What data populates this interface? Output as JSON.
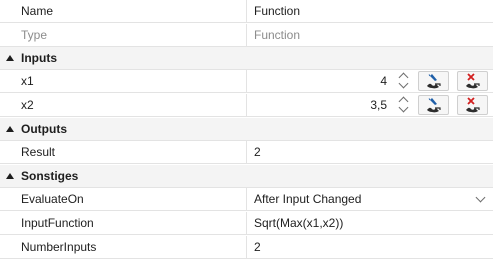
{
  "header": {
    "name": "Name",
    "value": "Function"
  },
  "type_row": {
    "name": "Type",
    "value": "Function"
  },
  "categories": {
    "inputs": "Inputs",
    "outputs": "Outputs",
    "sonstiges": "Sonstiges"
  },
  "inputs": [
    {
      "name": "x1",
      "value": "4"
    },
    {
      "name": "x2",
      "value": "3,5"
    }
  ],
  "outputs": [
    {
      "name": "Result",
      "value": "2"
    }
  ],
  "sonstiges": {
    "evaluate_on": {
      "name": "EvaluateOn",
      "value": "After Input Changed"
    },
    "input_function": {
      "name": "InputFunction",
      "value": "Sqrt(Max(x1,x2))"
    },
    "number_inputs": {
      "name": "NumberInputs",
      "value": "2"
    }
  },
  "icons": {
    "edit": "edit-input-icon",
    "clear": "clear-input-icon",
    "collapse": "collapse-triangle-icon",
    "dropdown": "chevron-down-icon"
  },
  "colors": {
    "category_background": "#f4f4f4",
    "grid_line": "#e3e3e3",
    "muted_text": "#8c8c8c",
    "icon_blue": "#1f5fa8",
    "icon_red": "#d21f1f"
  }
}
